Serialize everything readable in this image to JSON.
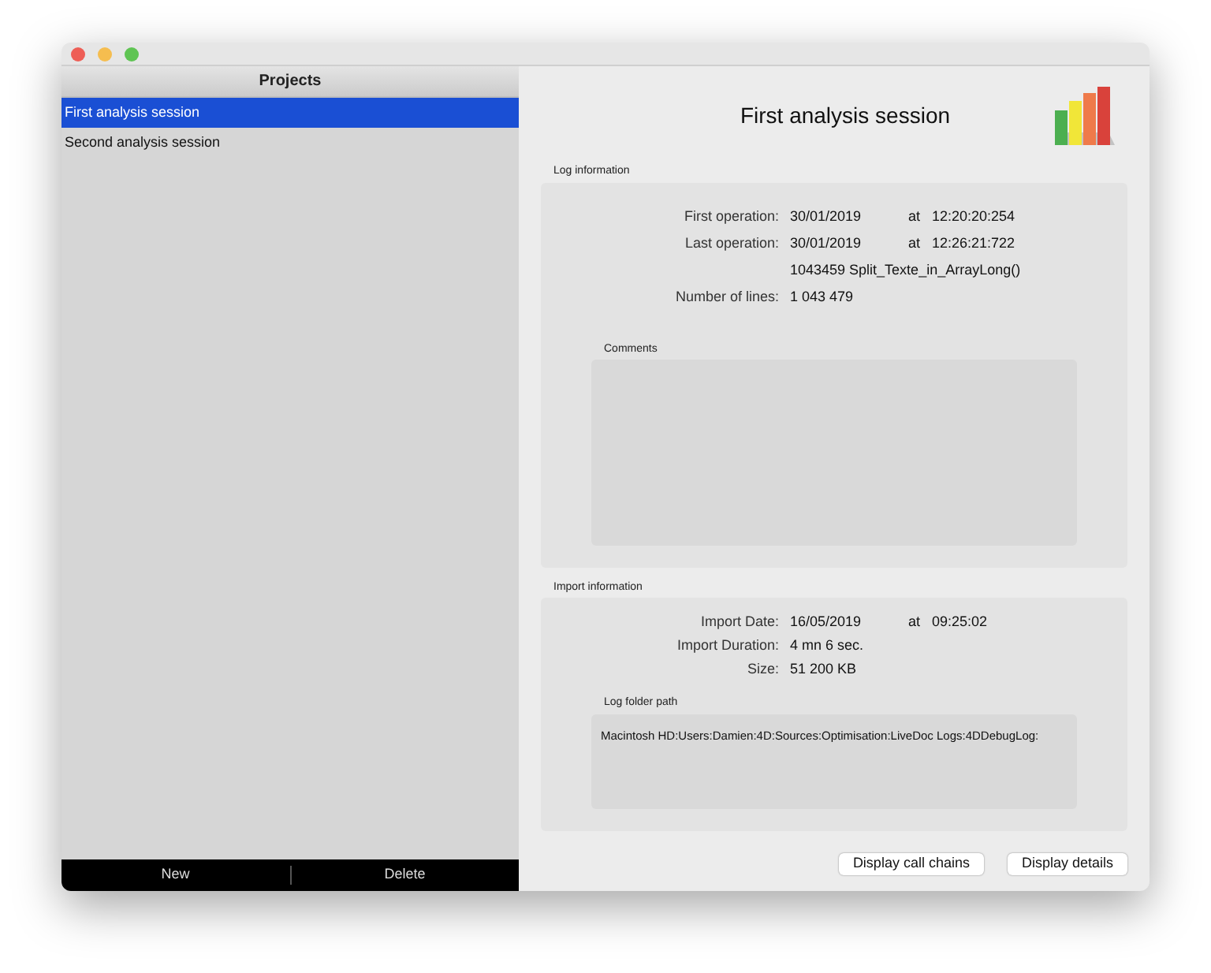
{
  "sidebar": {
    "header": "Projects",
    "items": [
      {
        "label": "First analysis session",
        "selected": true
      },
      {
        "label": "Second analysis session",
        "selected": false
      }
    ],
    "footer_buttons": [
      "New",
      "Delete"
    ]
  },
  "main": {
    "title": "First analysis session",
    "sections": [
      {
        "label": "Log information",
        "rows": [
          {
            "label": "First operation:",
            "value": "30/01/2019",
            "at": "at",
            "time": "12:20:20:254"
          },
          {
            "label": "Last operation:",
            "value": "30/01/2019",
            "at": "at",
            "time": "12:26:21:722"
          },
          {
            "value": "1043459 Split_Texte_in_ArrayLong()"
          },
          {
            "label": "Number of lines:",
            "value": "1 043 479"
          }
        ],
        "box": {
          "label": "Comments"
        }
      },
      {
        "label": "Import information",
        "rows": [
          {
            "label": "Import Date:",
            "value": "16/05/2019",
            "at": "at",
            "time": "09:25:02"
          },
          {
            "label": "Import Duration:",
            "value": "4 mn 6 sec."
          },
          {
            "label": "Size:",
            "value": "51 200 KB"
          }
        ],
        "box": {
          "label": "Log folder path",
          "value": "Macintosh HD:Users:Damien:4D:Sources:Optimisation:LiveDoc Logs:4DDebugLog:"
        }
      }
    ],
    "buttons": [
      "Display call chains",
      "Display details"
    ]
  }
}
